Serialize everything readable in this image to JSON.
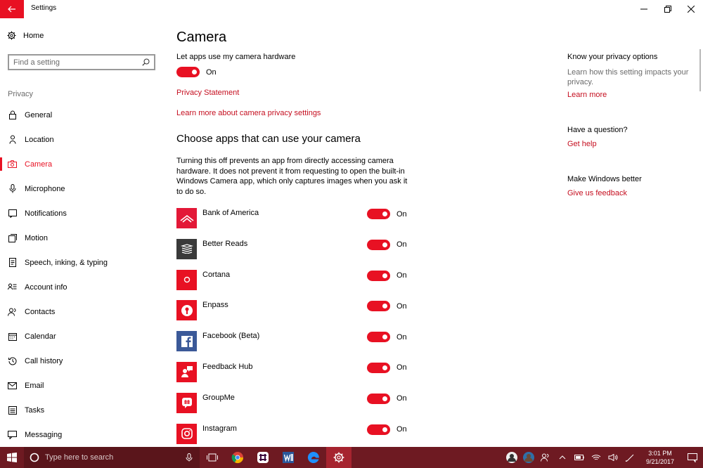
{
  "window": {
    "title": "Settings"
  },
  "sidebar": {
    "home_label": "Home",
    "search_placeholder": "Find a setting",
    "section_label": "Privacy",
    "items": [
      {
        "label": "General",
        "icon": "lock-icon"
      },
      {
        "label": "Location",
        "icon": "person-pin-icon"
      },
      {
        "label": "Camera",
        "icon": "camera-icon",
        "active": true
      },
      {
        "label": "Microphone",
        "icon": "microphone-icon"
      },
      {
        "label": "Notifications",
        "icon": "notification-icon"
      },
      {
        "label": "Motion",
        "icon": "motion-icon"
      },
      {
        "label": "Speech, inking, & typing",
        "icon": "document-icon"
      },
      {
        "label": "Account info",
        "icon": "account-info-icon"
      },
      {
        "label": "Contacts",
        "icon": "contacts-icon"
      },
      {
        "label": "Calendar",
        "icon": "calendar-icon"
      },
      {
        "label": "Call history",
        "icon": "history-icon"
      },
      {
        "label": "Email",
        "icon": "mail-icon"
      },
      {
        "label": "Tasks",
        "icon": "tasks-icon"
      },
      {
        "label": "Messaging",
        "icon": "messaging-icon"
      }
    ]
  },
  "main": {
    "title": "Camera",
    "hardware_label": "Let apps use my camera hardware",
    "hardware_state": "On",
    "privacy_statement": "Privacy Statement",
    "learn_more_link": "Learn more about camera privacy settings",
    "apps_heading": "Choose apps that can use your camera",
    "description": "Turning this off prevents an app from directly accessing camera hardware. It does not prevent it from requesting to open the built-in Windows Camera app, which only captures images when you ask it to do so.",
    "apps": [
      {
        "name": "Bank of America",
        "state": "On",
        "color": "#e31837",
        "icon": "bank-of-america-icon"
      },
      {
        "name": "Better Reads",
        "state": "On",
        "color": "#3a3a3a",
        "icon": "books-icon"
      },
      {
        "name": "Cortana",
        "state": "On",
        "color": "#e81123",
        "icon": "cortana-icon"
      },
      {
        "name": "Enpass",
        "state": "On",
        "color": "#e81123",
        "icon": "keyhole-icon"
      },
      {
        "name": "Facebook (Beta)",
        "state": "On",
        "color": "#3b5998",
        "icon": "facebook-icon"
      },
      {
        "name": "Feedback Hub",
        "state": "On",
        "color": "#e81123",
        "icon": "feedback-icon"
      },
      {
        "name": "GroupMe",
        "state": "On",
        "color": "#e81123",
        "icon": "groupme-icon"
      },
      {
        "name": "Instagram",
        "state": "On",
        "color": "#e81123",
        "icon": "instagram-icon"
      }
    ]
  },
  "right": {
    "privacy_heading": "Know your privacy options",
    "privacy_text": "Learn how this setting impacts your privacy.",
    "privacy_link": "Learn more",
    "question_heading": "Have a question?",
    "question_link": "Get help",
    "better_heading": "Make Windows better",
    "better_link": "Give us feedback"
  },
  "taskbar": {
    "search_placeholder": "Type here to search",
    "time": "3:01 PM",
    "date": "9/21/2017"
  },
  "colors": {
    "accent": "#e81123",
    "taskbar": "#6e1a22"
  }
}
